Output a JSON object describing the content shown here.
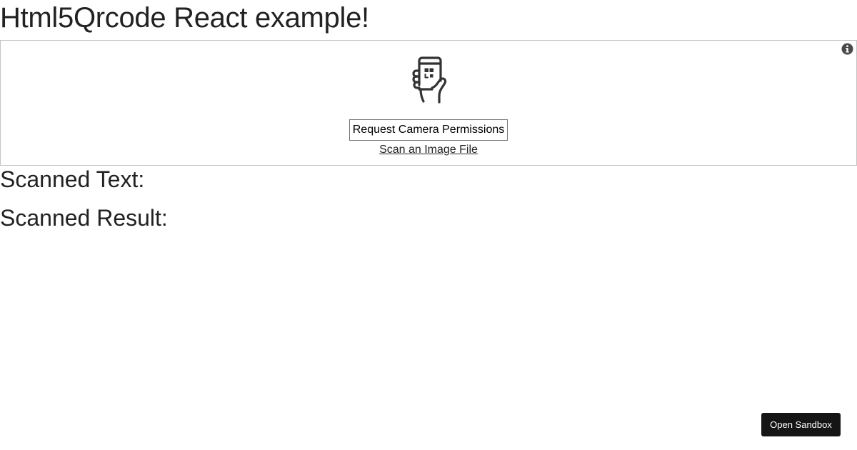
{
  "page": {
    "title": "Html5Qrcode React example!"
  },
  "scanner": {
    "info_icon": "info-icon",
    "illustration_icon": "phone-qr-scan-icon",
    "request_button_label": "Request Camera Permissions",
    "scan_file_label": "Scan an Image File"
  },
  "results": {
    "scanned_text_label": "Scanned Text:",
    "scanned_result_label": "Scanned Result:"
  },
  "sandbox": {
    "button_label": "Open Sandbox"
  },
  "colors": {
    "text": "#222222",
    "border": "#c4c4c4",
    "sandbox_bg": "#151515",
    "icon": "#333333"
  }
}
